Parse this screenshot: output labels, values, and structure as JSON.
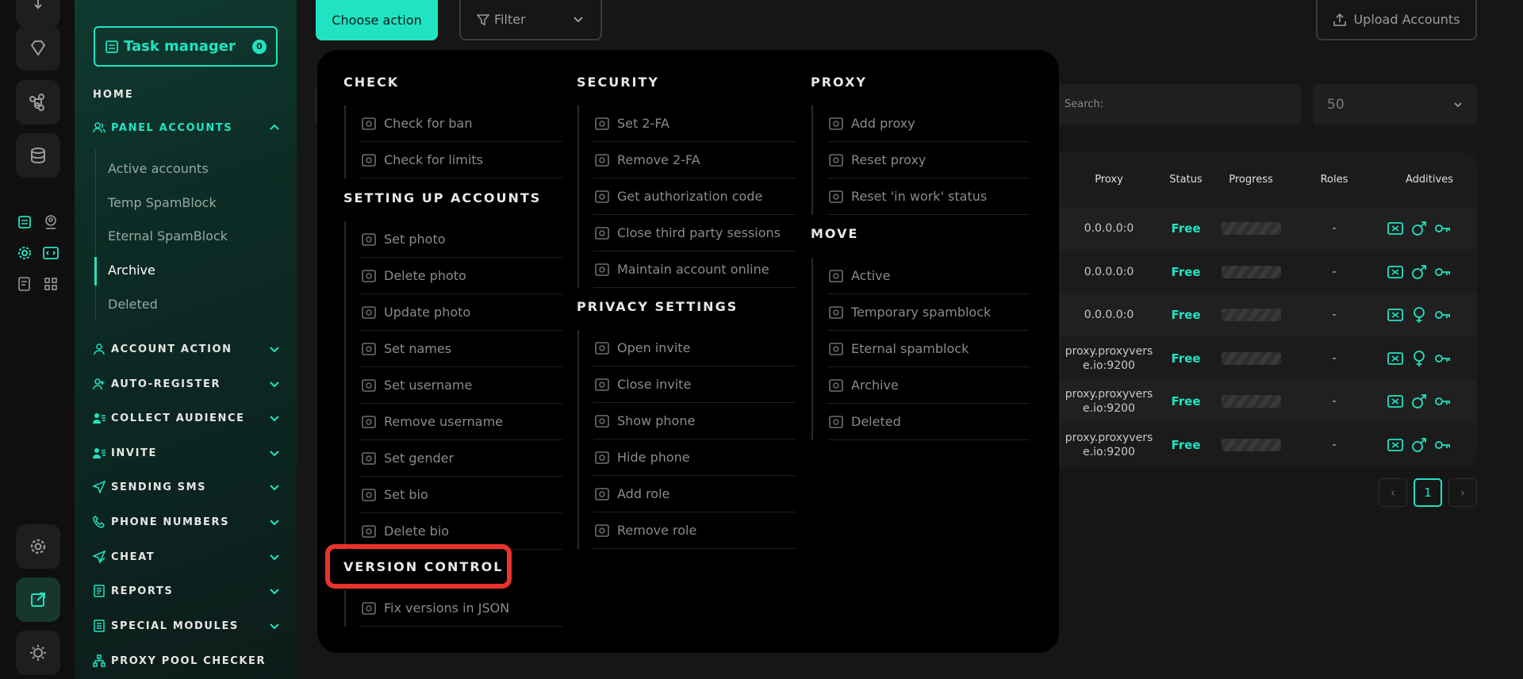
{
  "task_manager": {
    "label": "Task manager",
    "count": "0"
  },
  "sidebar": {
    "home": "HOME",
    "panel_accounts": "PANEL ACCOUNTS",
    "sub_items": [
      "Active accounts",
      "Temp SpamBlock",
      "Eternal SpamBlock",
      "Archive",
      "Deleted"
    ],
    "sections": [
      "ACCOUNT ACTION",
      "AUTO-REGISTER",
      "COLLECT AUDIENCE",
      "INVITE",
      "SENDING SMS",
      "PHONE NUMBERS",
      "CHEAT",
      "REPORTS",
      "SPECIAL MODULES",
      "PROXY POOL CHECKER"
    ]
  },
  "toolbar": {
    "choose_action": "Choose action",
    "filter": "Filter",
    "upload": "Upload Accounts"
  },
  "search": {
    "placeholder": "Search:"
  },
  "per_page": "50",
  "table": {
    "headers": [
      "Proxy",
      "Status",
      "Progress",
      "Roles",
      "Additives"
    ],
    "rows": [
      {
        "proxy": "0.0.0.0:0",
        "status": "Free",
        "roles": "-",
        "gender": "male"
      },
      {
        "proxy": "0.0.0.0:0",
        "status": "Free",
        "roles": "-",
        "gender": "male"
      },
      {
        "proxy": "0.0.0.0:0",
        "status": "Free",
        "roles": "-",
        "gender": "female"
      },
      {
        "proxy": "proxy.proxyvers\ne.io:9200",
        "status": "Free",
        "roles": "-",
        "gender": "female"
      },
      {
        "proxy": "proxy.proxyvers\ne.io:9200",
        "status": "Free",
        "roles": "-",
        "gender": "male"
      },
      {
        "proxy": "proxy.proxyvers\ne.io:9200",
        "status": "Free",
        "roles": "-",
        "gender": "male"
      }
    ]
  },
  "pagination": {
    "current": "1",
    "prev": "‹",
    "next": "›"
  },
  "menu": {
    "check": {
      "title": "CHECK",
      "items": [
        "Check for ban",
        "Check for limits"
      ]
    },
    "setting_up": {
      "title": "SETTING UP ACCOUNTS",
      "items": [
        "Set photo",
        "Delete photo",
        "Update photo",
        "Set names",
        "Set username",
        "Remove username",
        "Set gender",
        "Set bio",
        "Delete bio"
      ]
    },
    "version_control": {
      "title": "VERSION CONTROL",
      "items": [
        "Fix versions in JSON"
      ]
    },
    "security": {
      "title": "SECURITY",
      "items": [
        "Set 2-FA",
        "Remove 2-FA",
        "Get authorization code",
        "Close third party sessions",
        "Maintain account online"
      ]
    },
    "privacy": {
      "title": "PRIVACY SETTINGS",
      "items": [
        "Open invite",
        "Close invite",
        "Show phone",
        "Hide phone",
        "Add role",
        "Remove role"
      ]
    },
    "proxy": {
      "title": "PROXY",
      "items": [
        "Add proxy",
        "Reset proxy",
        "Reset 'in work' status"
      ]
    },
    "move": {
      "title": "MOVE",
      "items": [
        "Active",
        "Temporary spamblock",
        "Eternal spamblock",
        "Archive",
        "Deleted"
      ]
    }
  },
  "colors": {
    "accent": "#20e3c2",
    "highlight": "#e8332d",
    "menu_bg": "#000000"
  }
}
